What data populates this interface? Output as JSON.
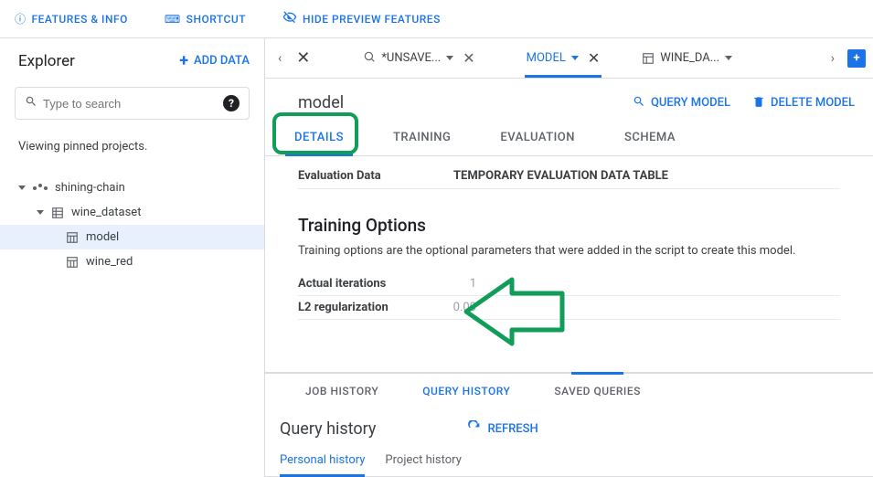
{
  "topbar": {
    "features": "FEATURES & INFO",
    "shortcut": "SHORTCUT",
    "hide_preview": "HIDE PREVIEW FEATURES"
  },
  "sidebar": {
    "title": "Explorer",
    "add_data": "ADD DATA",
    "search_placeholder": "Type to search",
    "pinned_note": "Viewing pinned projects.",
    "project": "shining-chain",
    "dataset": "wine_dataset",
    "items": [
      "model",
      "wine_red"
    ]
  },
  "tabs": {
    "unsaved": "*UNSAVE...",
    "model": "MODEL",
    "wine": "WINE_DA..."
  },
  "panel": {
    "title": "model",
    "actions": {
      "query": "QUERY MODEL",
      "delete": "DELETE MODEL"
    },
    "subtabs": [
      "DETAILS",
      "TRAINING",
      "EVALUATION",
      "SCHEMA"
    ],
    "eval_label": "Evaluation Data",
    "eval_value": "TEMPORARY EVALUATION DATA TABLE",
    "training_title": "Training Options",
    "training_desc": "Training options are the optional parameters that were added in the script to create this model.",
    "options": [
      {
        "label": "Actual iterations",
        "value": "1"
      },
      {
        "label": "L2 regularization",
        "value": "0.00"
      }
    ]
  },
  "bottom": {
    "tabs": [
      "JOB HISTORY",
      "QUERY HISTORY",
      "SAVED QUERIES"
    ],
    "title": "Query history",
    "refresh": "REFRESH",
    "hist_tabs": [
      "Personal history",
      "Project history"
    ]
  }
}
